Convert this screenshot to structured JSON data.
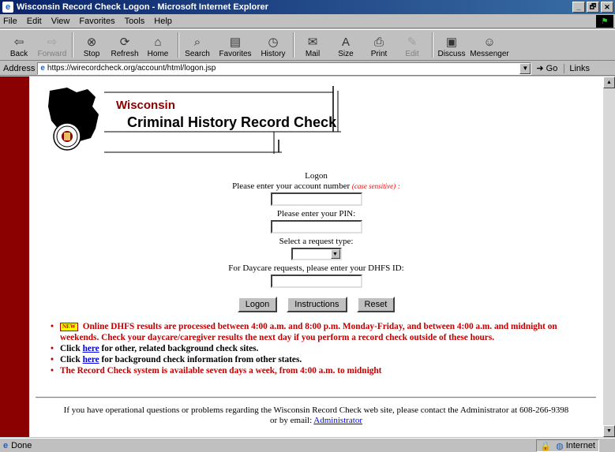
{
  "window": {
    "title": "Wisconsin Record Check Logon - Microsoft Internet Explorer",
    "controls": [
      "_",
      "🗗",
      "✕"
    ]
  },
  "menu": [
    "File",
    "Edit",
    "View",
    "Favorites",
    "Tools",
    "Help"
  ],
  "toolbar": [
    {
      "label": "Back",
      "icon": "back-arrow-icon",
      "glyph": "⇦",
      "enabled": true
    },
    {
      "label": "Forward",
      "icon": "forward-arrow-icon",
      "glyph": "⇨",
      "enabled": false
    },
    {
      "label": "Stop",
      "icon": "stop-icon",
      "glyph": "⊗",
      "enabled": true
    },
    {
      "label": "Refresh",
      "icon": "refresh-icon",
      "glyph": "⟳",
      "enabled": true
    },
    {
      "label": "Home",
      "icon": "home-icon",
      "glyph": "⌂",
      "enabled": true
    },
    {
      "label": "Search",
      "icon": "search-icon",
      "glyph": "⌕",
      "enabled": true
    },
    {
      "label": "Favorites",
      "icon": "favorites-icon",
      "glyph": "▤",
      "enabled": true
    },
    {
      "label": "History",
      "icon": "history-icon",
      "glyph": "◷",
      "enabled": true
    },
    {
      "label": "Mail",
      "icon": "mail-icon",
      "glyph": "✉",
      "enabled": true
    },
    {
      "label": "Size",
      "icon": "size-icon",
      "glyph": "A",
      "enabled": true
    },
    {
      "label": "Print",
      "icon": "print-icon",
      "glyph": "⎙",
      "enabled": true
    },
    {
      "label": "Edit",
      "icon": "edit-icon",
      "glyph": "✎",
      "enabled": false
    },
    {
      "label": "Discuss",
      "icon": "discuss-icon",
      "glyph": "▣",
      "enabled": true
    },
    {
      "label": "Messenger",
      "icon": "messenger-icon",
      "glyph": "☺",
      "enabled": true
    }
  ],
  "address": {
    "label": "Address",
    "url": "https://wirecordcheck.org/account/html/logon.jsp",
    "go_label": "Go",
    "links_label": "Links"
  },
  "logo": {
    "line1": "Wisconsin",
    "line2": "Criminal History Record Check"
  },
  "form": {
    "heading": "Logon",
    "account_prompt": "Please enter your account number",
    "case_note": "(case sensitive)",
    "account_suffix": ":",
    "pin_prompt": "Please enter your PIN:",
    "request_prompt": "Select a request type:",
    "dhfs_prompt": "For Daycare requests, please enter your DHFS ID:"
  },
  "buttons": {
    "logon": "Logon",
    "instructions": "Instructions",
    "reset": "Reset"
  },
  "notes": {
    "new_badge": "NEW",
    "item1": "Online DHFS results are processed between 4:00 a.m. and 8:00 p.m. Monday-Friday, and between 4:00 a.m. and midnight on weekends.   Check your daycare/caregiver results the next day if you perform a record check outside of these hours.",
    "item2_prefix": "Click",
    "item2_link": "here",
    "item2_suffix": "for other, related background check sites.",
    "item3_prefix": "Click",
    "item3_link": "here",
    "item3_suffix": "for background check information from other states.",
    "item4": "The Record Check system is available seven days a week, from 4:00 a.m. to midnight"
  },
  "footer": {
    "line1": "If you have operational questions or problems regarding the Wisconsin Record Check web site, please contact the Administrator at 608-266-9398",
    "line2_prefix": "or by email:",
    "email_link": "Administrator"
  },
  "status": {
    "text": "Done",
    "zone": "Internet"
  }
}
